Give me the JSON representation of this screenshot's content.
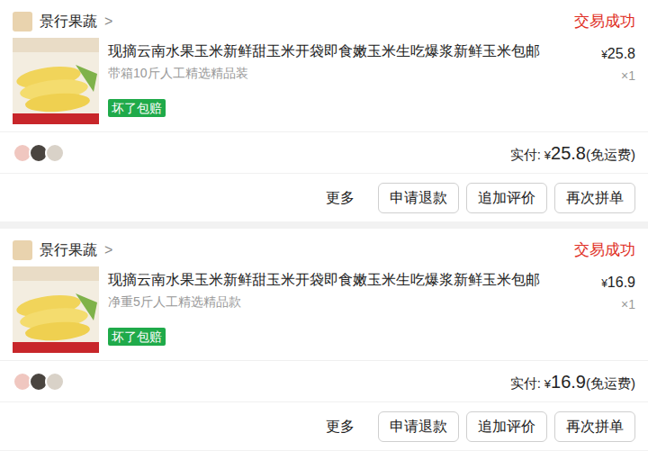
{
  "orders": [
    {
      "shop": "景行果蔬",
      "chevron": ">",
      "status": "交易成功",
      "title": "现摘云南水果玉米新鲜甜玉米开袋即食嫩玉米生吃爆浆新鲜玉米包邮",
      "spec": "带箱10斤人工精选精品装",
      "badge": "坏了包赔",
      "price_currency": "¥",
      "price": "25.8",
      "quantity": "×1",
      "paid_label": "实付:",
      "paid_currency": "¥",
      "paid_amount": "25.8",
      "shipping": "(免运费)",
      "more": "更多",
      "buttons": [
        "申请退款",
        "追加评价",
        "再次拼单"
      ]
    },
    {
      "shop": "景行果蔬",
      "chevron": ">",
      "status": "交易成功",
      "title": "现摘云南水果玉米新鲜甜玉米开袋即食嫩玉米生吃爆浆新鲜玉米包邮",
      "spec": "净重5斤人工精选精品款",
      "badge": "坏了包赔",
      "price_currency": "¥",
      "price": "16.9",
      "quantity": "×1",
      "paid_label": "实付:",
      "paid_currency": "¥",
      "paid_amount": "16.9",
      "shipping": "(免运费)",
      "more": "更多",
      "buttons": [
        "申请退款",
        "追加评价",
        "再次拼单"
      ]
    }
  ]
}
